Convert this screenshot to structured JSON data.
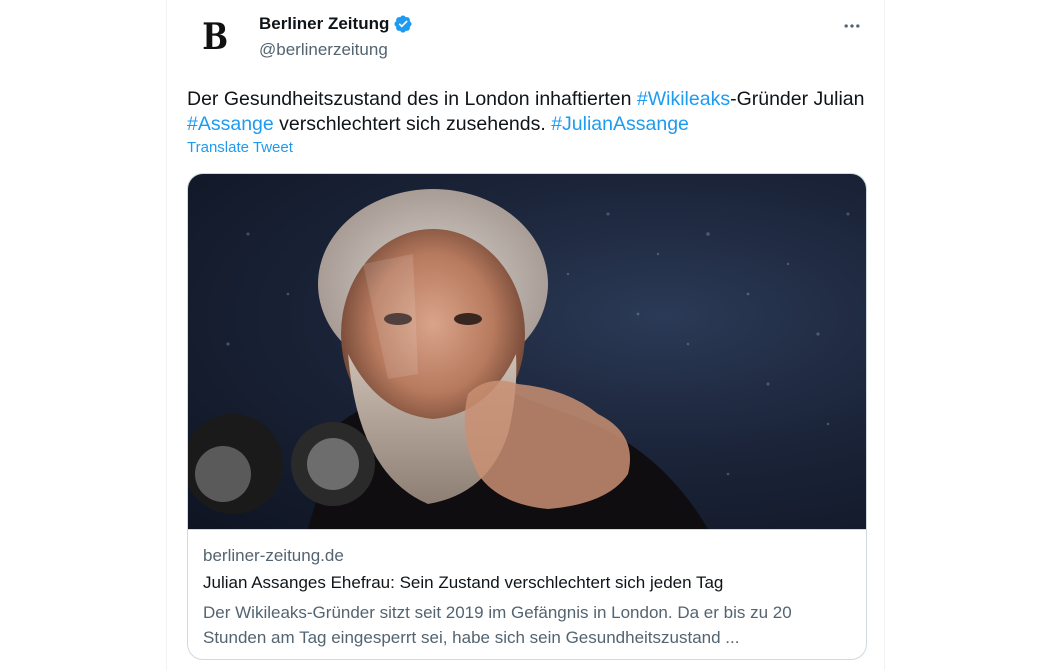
{
  "author": {
    "name": "Berliner Zeitung",
    "handle": "@berlinerzeitung",
    "avatar_letter": "B",
    "verified": true
  },
  "tweet": {
    "segments": [
      {
        "text": "Der Gesundheitszustand des in London inhaftierten ",
        "type": "text"
      },
      {
        "text": "#Wikileaks",
        "type": "hashtag"
      },
      {
        "text": "-Gründer Julian ",
        "type": "text"
      },
      {
        "text": "#Assange",
        "type": "hashtag"
      },
      {
        "text": " verschlechtert sich zusehends. ",
        "type": "text"
      },
      {
        "text": "#JulianAssange",
        "type": "hashtag"
      }
    ],
    "translate_label": "Translate Tweet"
  },
  "card": {
    "domain": "berliner-zeitung.de",
    "title": "Julian Assanges Ehefrau: Sein Zustand verschlechtert sich jeden Tag",
    "description": "Der Wikileaks-Gründer sitzt seit 2019 im Gefängnis in London. Da er bis zu 20 Stunden am Tag eingesperrt sei, habe sich sein Gesundheitszustand ..."
  },
  "icons": {
    "verified": "verified-badge-icon",
    "more": "more-options-icon"
  },
  "colors": {
    "accent": "#1d9bf0",
    "text": "#0f1419",
    "secondary": "#536471",
    "border": "#cfd9de"
  }
}
